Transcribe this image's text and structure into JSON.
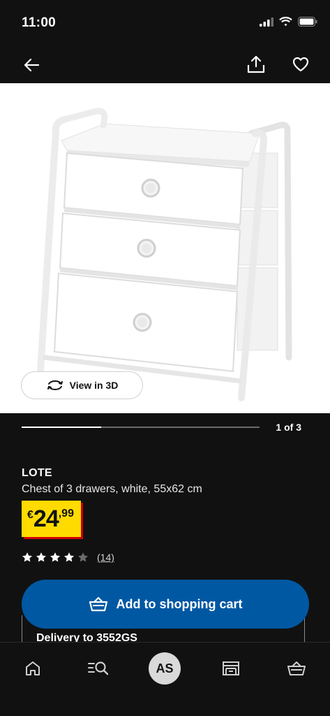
{
  "status_bar": {
    "time": "11:00"
  },
  "top_bar": {
    "back_icon": "arrow-left-icon",
    "share_icon": "share-icon",
    "favorite_icon": "heart-icon"
  },
  "hero": {
    "view_3d_label": "View in 3D"
  },
  "carousel": {
    "counter": "1 of 3",
    "progress_fraction": 0.333
  },
  "product": {
    "name": "LOTE",
    "description": "Chest of 3 drawers, white, 55x62 cm",
    "price": {
      "currency": "€",
      "integer": "24",
      "decimal": ",99"
    },
    "rating": {
      "stars": 4,
      "max": 5,
      "count_label": "(14)"
    }
  },
  "cart": {
    "label": "Add to shopping cart"
  },
  "delivery": {
    "label": "Delivery to 3552GS"
  },
  "nav": {
    "avatar_initials": "AS",
    "items": [
      "home-icon",
      "search-icon",
      "avatar",
      "store-icon",
      "basket-icon"
    ]
  },
  "colors": {
    "accent_blue": "#0058a3",
    "price_yellow": "#ffdb00",
    "price_shadow": "#cc0008",
    "background": "#111111"
  }
}
